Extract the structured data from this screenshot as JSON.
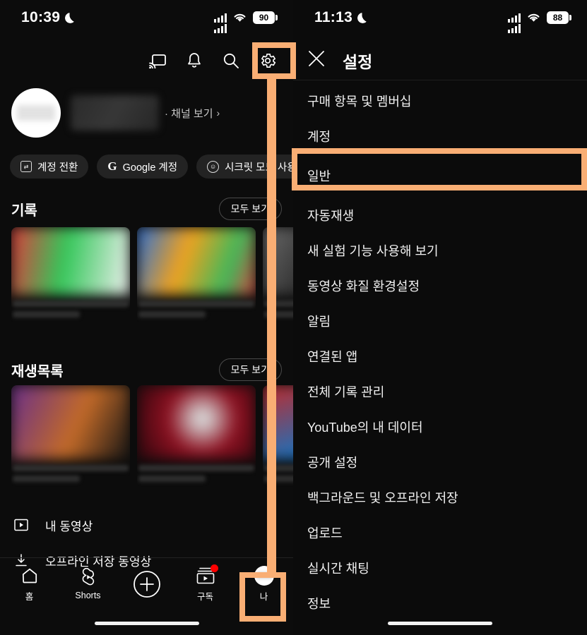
{
  "annotation": {
    "color": "#f9ae74",
    "steps": [
      "gear-icon",
      "general-menu-item",
      "you-tab"
    ]
  },
  "left_panel": {
    "statusbar": {
      "time": "10:39",
      "dnd_icon": "moon-icon",
      "signal_icon": "signal-bars-icon",
      "wifi_icon": "wifi-icon",
      "battery_level": "90"
    },
    "toolbar": {
      "icons": [
        {
          "name": "cast-icon",
          "label": "Cast"
        },
        {
          "name": "bell-icon",
          "label": "Notifications"
        },
        {
          "name": "search-icon",
          "label": "Search"
        },
        {
          "name": "gear-icon",
          "label": "Settings"
        }
      ]
    },
    "account": {
      "avatar": "user-avatar",
      "name": "",
      "channel_link": "· 채널 보기",
      "chevron": "›",
      "chips": [
        {
          "icon": "switch-account-icon",
          "label": "계정 전환"
        },
        {
          "icon": "google-g-icon",
          "label": "Google 계정"
        },
        {
          "icon": "incognito-icon",
          "label": "시크릿 모드 사용"
        }
      ]
    },
    "history": {
      "title": "기록",
      "view_all": "모두 보기",
      "thumbnails": [
        {
          "c1": "#de3b3b",
          "c2": "#34c75a",
          "c3": "#f0f0f0"
        },
        {
          "c1": "#2b6fd8",
          "c2": "#f0a21e",
          "c3": "#41b85a"
        },
        {
          "c1": "#6a6a6a",
          "c2": "#2a2a2a",
          "c3": "#9a9a9a"
        }
      ]
    },
    "playlists": {
      "title": "재생목록",
      "view_all": "모두 보기",
      "thumbnails": [
        {
          "c1": "#6a2f8a",
          "c2": "#c26a28",
          "c3": "#1b1b1b"
        },
        {
          "c1": "#8c1020",
          "c2": "#d8d8d8",
          "c3": "#3a0a12"
        },
        {
          "c1": "#c22a2a",
          "c2": "#1f6fb8",
          "c3": "#101010"
        }
      ]
    },
    "links": [
      {
        "icon": "my-videos-icon",
        "label": "내 동영상"
      },
      {
        "icon": "download-icon",
        "label": "오프라인 저장 동영상"
      }
    ],
    "bottom_nav": [
      {
        "name": "home",
        "icon": "home-icon",
        "label": "홈",
        "badge": false
      },
      {
        "name": "shorts",
        "icon": "shorts-icon",
        "label": "Shorts",
        "badge": false
      },
      {
        "name": "create",
        "icon": "plus-circle-icon",
        "label": "",
        "badge": false
      },
      {
        "name": "subscriptions",
        "icon": "subscriptions-icon",
        "label": "구독",
        "badge": true
      },
      {
        "name": "you",
        "icon": "avatar-icon",
        "label": "나",
        "badge": false
      }
    ]
  },
  "right_panel": {
    "statusbar": {
      "time": "11:13",
      "dnd_icon": "moon-icon",
      "signal_icon": "signal-bars-icon",
      "wifi_icon": "wifi-icon",
      "battery_level": "88"
    },
    "header": {
      "close_icon": "close-icon",
      "title": "설정"
    },
    "menu_items": [
      {
        "label": "구매 항목 및 멤버십",
        "highlighted": false
      },
      {
        "label": "계정",
        "highlighted": false
      },
      {
        "label": "일반",
        "highlighted": true
      },
      {
        "label": "자동재생",
        "highlighted": false
      },
      {
        "label": "새 실험 기능 사용해 보기",
        "highlighted": false
      },
      {
        "label": "동영상 화질 환경설정",
        "highlighted": false
      },
      {
        "label": "알림",
        "highlighted": false
      },
      {
        "label": "연결된 앱",
        "highlighted": false
      },
      {
        "label": "전체 기록 관리",
        "highlighted": false
      },
      {
        "label": "YouTube의 내 데이터",
        "highlighted": false
      },
      {
        "label": "공개 설정",
        "highlighted": false
      },
      {
        "label": "백그라운드 및 오프라인 저장",
        "highlighted": false
      },
      {
        "label": "업로드",
        "highlighted": false
      },
      {
        "label": "실시간 채팅",
        "highlighted": false
      },
      {
        "label": "정보",
        "highlighted": false
      }
    ]
  }
}
